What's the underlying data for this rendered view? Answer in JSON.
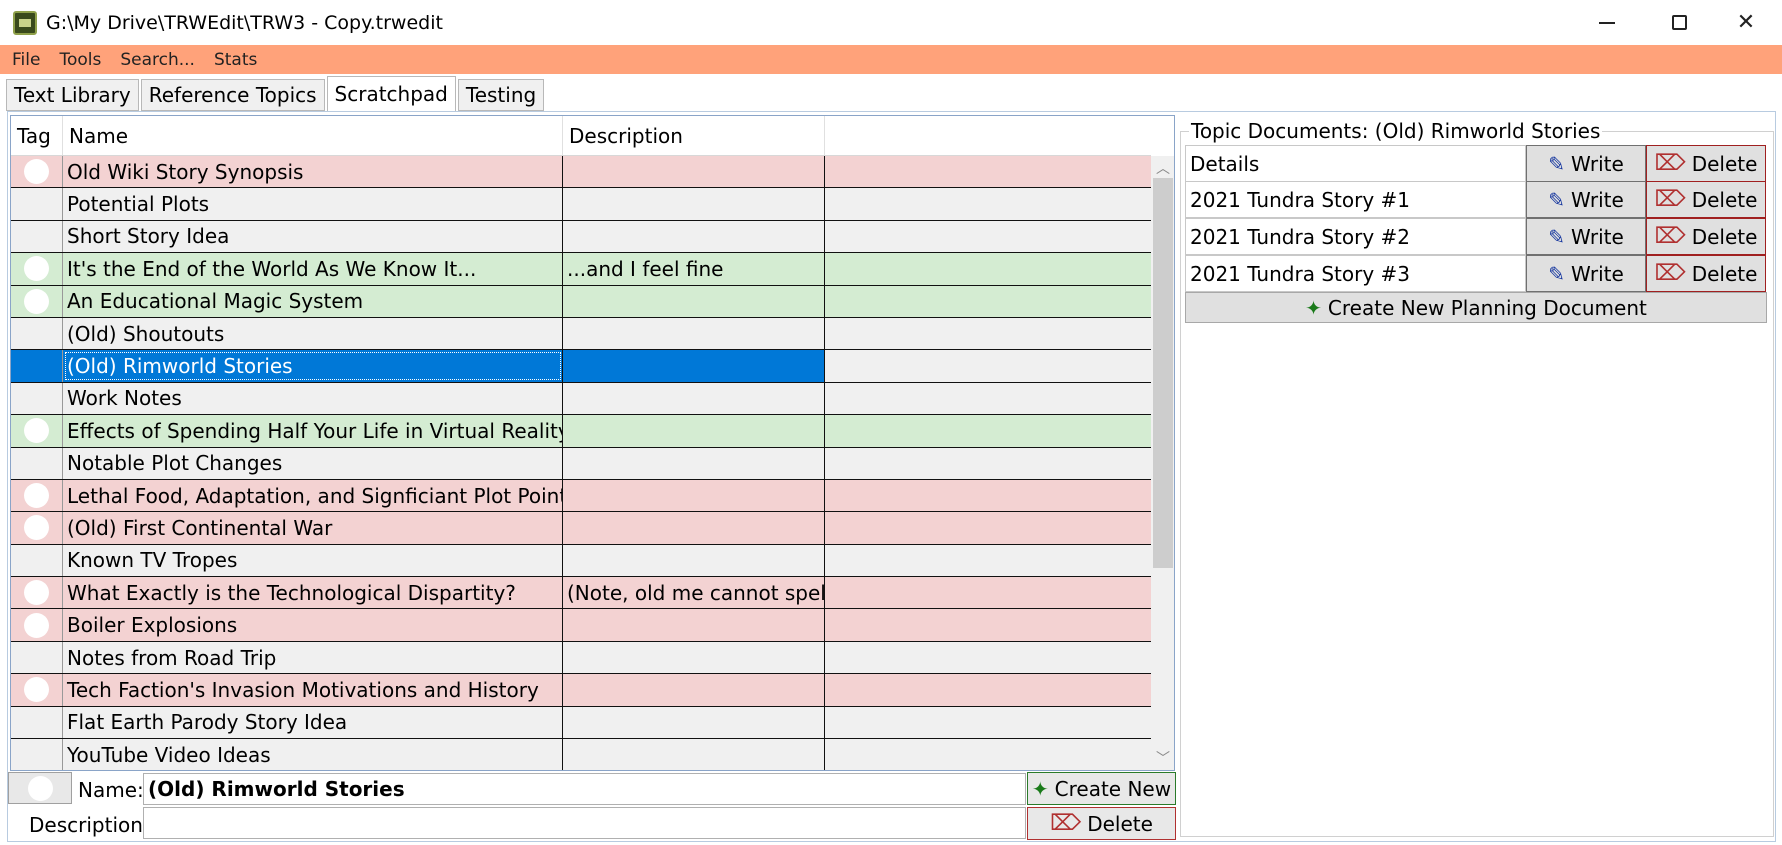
{
  "window": {
    "title": "G:\\My Drive\\TRWEdit\\TRW3 - Copy.trwedit",
    "minimize_glyph": "",
    "maximize_glyph": "",
    "close_glyph": "✕"
  },
  "menu": [
    "File",
    "Tools",
    "Search...",
    "Stats"
  ],
  "tabs": [
    {
      "label": "Text Library",
      "active": false
    },
    {
      "label": "Reference Topics",
      "active": false
    },
    {
      "label": "Scratchpad",
      "active": true
    },
    {
      "label": "Testing",
      "active": false
    }
  ],
  "grid": {
    "columns": [
      "Tag",
      "Name",
      "Description"
    ],
    "rows": [
      {
        "name": "Old Wiki Story Synopsis",
        "description": "",
        "tag": "red"
      },
      {
        "name": "Potential Plots",
        "description": "",
        "tag": "none"
      },
      {
        "name": "Short Story Idea",
        "description": "",
        "tag": "none"
      },
      {
        "name": "It's the End of the World As We Know It...",
        "description": "...and I feel fine",
        "tag": "green"
      },
      {
        "name": "An Educational Magic System",
        "description": "",
        "tag": "green"
      },
      {
        "name": "(Old) Shoutouts",
        "description": "",
        "tag": "none"
      },
      {
        "name": "(Old) Rimworld Stories",
        "description": "",
        "tag": "selected"
      },
      {
        "name": "Work Notes",
        "description": "",
        "tag": "none"
      },
      {
        "name": "Effects of Spending Half Your Life in Virtual Reality",
        "description": "",
        "tag": "green"
      },
      {
        "name": "Notable Plot Changes",
        "description": "",
        "tag": "none"
      },
      {
        "name": "Lethal Food, Adaptation, and Signficiant Plot Points",
        "description": "",
        "tag": "red"
      },
      {
        "name": "(Old) First Continental War",
        "description": "",
        "tag": "red"
      },
      {
        "name": "Known TV Tropes",
        "description": "",
        "tag": "none"
      },
      {
        "name": "What Exactly is the Technological Dispartity?",
        "description": "(Note, old me cannot spell)",
        "tag": "red"
      },
      {
        "name": "Boiler Explosions",
        "description": "",
        "tag": "red"
      },
      {
        "name": "Notes from Road Trip",
        "description": "",
        "tag": "none"
      },
      {
        "name": "Tech Faction's Invasion Motivations and History",
        "description": "",
        "tag": "red"
      },
      {
        "name": "Flat Earth Parody Story Idea",
        "description": "",
        "tag": "none"
      },
      {
        "name": "YouTube Video Ideas",
        "description": "",
        "tag": "none"
      }
    ],
    "scroll_up_glyph": "︿",
    "scroll_down_glyph": "﹀"
  },
  "editor": {
    "name_label": "Name:",
    "name_value": "(Old) Rimworld Stories",
    "description_label": "Description:",
    "description_value": "",
    "create_label": "Create New",
    "delete_label": "Delete"
  },
  "topic_docs": {
    "title": "Topic Documents: (Old) Rimworld Stories",
    "documents": [
      {
        "name": "Details"
      },
      {
        "name": "2021 Tundra Story #1"
      },
      {
        "name": "2021 Tundra Story #2"
      },
      {
        "name": "2021 Tundra Story #3"
      }
    ],
    "write_label": "Write",
    "delete_label": "Delete",
    "create_label": "Create New Planning Document"
  },
  "icons": {
    "plus": "✦",
    "delete": "⌦",
    "pencil": "✎"
  },
  "colors": {
    "menu_bar": "#ffa27a",
    "tag_red": "#f3d2d2",
    "tag_green": "#d4ecd2",
    "selection": "#0078d7"
  }
}
